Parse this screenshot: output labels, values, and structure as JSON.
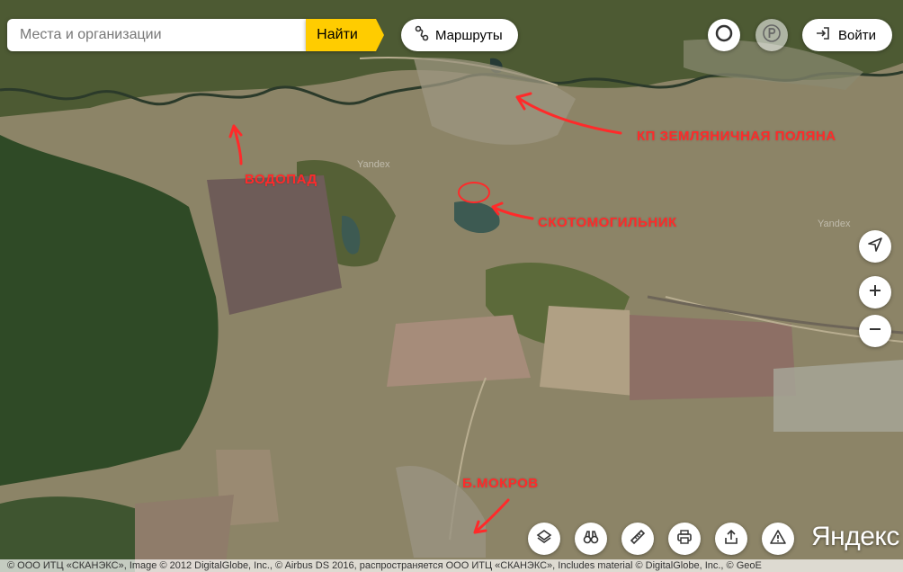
{
  "search": {
    "placeholder": "Места и организации",
    "button_label": "Найти"
  },
  "routes_label": "Маршруты",
  "login_label": "Войти",
  "annotations": {
    "village": "КП ЗЕМЛЯНИЧНАЯ ПОЛЯНА",
    "waterfall": "ВОДОПАД",
    "burial": "СКОТОМОГИЛЬНИК",
    "mokrov": "Б.МОКРОВ"
  },
  "watermark": "Yandex",
  "logo_text": "Яндекс",
  "copyright": "© ООО ИТЦ «СКАНЭКС», Image © 2012 DigitalGlobe, Inc., © Airbus DS 2016, распространяется ООО ИТЦ «СКАНЭКС», Includes material © DigitalGlobe, Inc., © GeoE",
  "colors": {
    "accent": "#ffcc00",
    "annotation": "#ff2a2a"
  }
}
